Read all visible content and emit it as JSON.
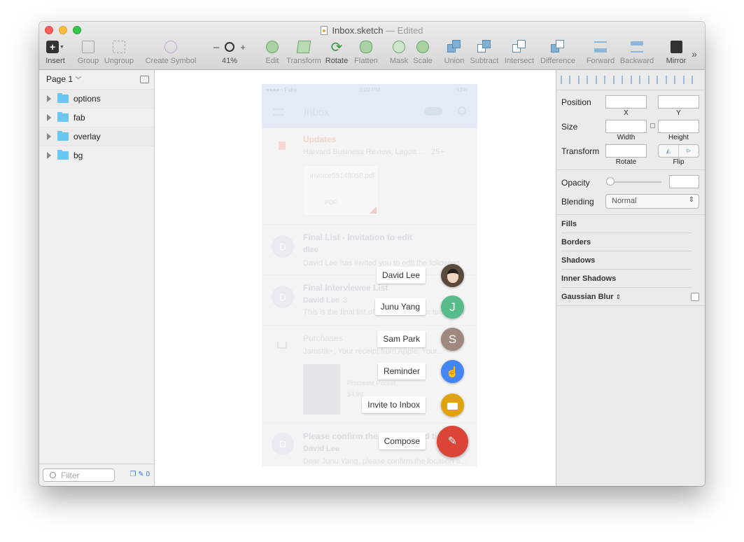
{
  "window": {
    "filename": "Inbox.sketch",
    "edited": "— Edited"
  },
  "toolbar": {
    "insert": "Insert",
    "group": "Group",
    "ungroup": "Ungroup",
    "create_symbol": "Create Symbol",
    "zoom_minus": "–",
    "zoom_plus": "+",
    "zoom_level": "41%",
    "edit": "Edit",
    "transform": "Transform",
    "rotate": "Rotate",
    "flatten": "Flatten",
    "mask": "Mask",
    "scale": "Scale",
    "union": "Union",
    "subtract": "Subtract",
    "intersect": "Intersect",
    "difference": "Difference",
    "forward": "Forward",
    "backward": "Backward",
    "mirror": "Mirror",
    "more": "»"
  },
  "layers_panel": {
    "page": "Page 1",
    "layers": [
      {
        "name": "options"
      },
      {
        "name": "fab"
      },
      {
        "name": "overlay"
      },
      {
        "name": "bg"
      }
    ],
    "filter_placeholder": "Filter",
    "slice_count": "0"
  },
  "artboard": {
    "status_time": "3:09 PM",
    "status_left": "●●●●○ Fake",
    "status_right": "93%",
    "title": "Inbox",
    "bg_items": {
      "updates_title": "Updates",
      "updates_sub": "Harvard Business Review, Lagoa ...",
      "updates_count": "25+",
      "attachment_name": "invoice55148058.pdf",
      "attachment_type": "PDF",
      "item1_title": "Final List - Invitation to edit",
      "item1_sender": "dlee",
      "item1_snippet": "David Lee has invited you to edit the following",
      "item1_avatar": "D",
      "item2_title": "Final Interviewee List",
      "item2_sender": "David Lee",
      "item2_count": "3",
      "item2_snippet": "This is the final list of interviewees for tomorrow",
      "item2_avatar": "D",
      "purchases_title": "Purchases",
      "purchases_sub": "Jamstik+, Your receipt from Apple, Your...",
      "product_name": "Procreate Pocket",
      "product_price": "$4.99",
      "item3_title": "Please confirm the location and time",
      "item3_sender": "David Lee",
      "item3_snippet": "Dear Junu Yang, please confirm the location a...",
      "item3_avatar": "D"
    },
    "fab_options": [
      {
        "label": "David Lee",
        "icon": "photo-avatar",
        "color": "#5a4a3c"
      },
      {
        "label": "Junu Yang",
        "icon": "J",
        "color": "#57bb8a"
      },
      {
        "label": "Sam Park",
        "icon": "S",
        "color": "#a1887f"
      },
      {
        "label": "Reminder",
        "icon": "reminder-hand-icon",
        "color": "#4285f4"
      },
      {
        "label": "Invite to Inbox",
        "icon": "ticket-icon",
        "color": "#e0a30b"
      }
    ],
    "compose": {
      "label": "Compose",
      "icon": "pin-icon",
      "color": "#db4437"
    }
  },
  "inspector": {
    "position": "Position",
    "x": "X",
    "y": "Y",
    "size": "Size",
    "width": "Width",
    "height": "Height",
    "transform": "Transform",
    "rotate": "Rotate",
    "flip": "Flip",
    "opacity": "Opacity",
    "blending": "Blending",
    "blending_value": "Normal",
    "fills": "Fills",
    "borders": "Borders",
    "shadows": "Shadows",
    "inner_shadows": "Inner Shadows",
    "gaussian_blur": "Gaussian Blur"
  }
}
